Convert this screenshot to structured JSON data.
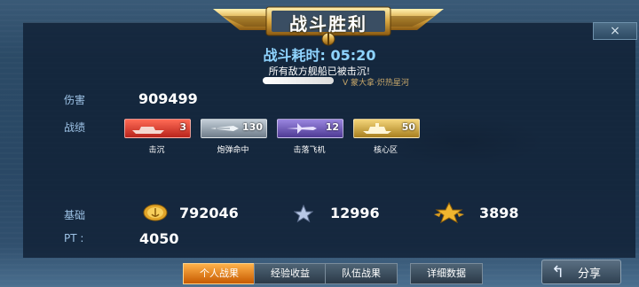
{
  "banner": {
    "title": "战斗胜利"
  },
  "close": {
    "icon": "×"
  },
  "summary": {
    "time_label": "战斗耗时:",
    "time_value": "05:20",
    "result": "所有敌方舰船已被击沉!",
    "player_info": "V 蒙大拿·炽热星河"
  },
  "stats": {
    "damage_label": "伤害",
    "damage_value": "909499",
    "record_label": "战绩",
    "badges": [
      {
        "icon": "ship-icon",
        "count": "3",
        "caption": "击沉",
        "color": "#d2352b"
      },
      {
        "icon": "shell-icon",
        "count": "130",
        "caption": "炮弹命中",
        "color": "#8a98a6"
      },
      {
        "icon": "aircraft-icon",
        "count": "12",
        "caption": "击落飞机",
        "color": "#6b55b0"
      },
      {
        "icon": "core-icon",
        "count": "50",
        "caption": "核心区",
        "color": "#c9a340"
      }
    ],
    "base_label": "基础",
    "gold_value": "792046",
    "silver_star_value": "12996",
    "gold_star_value": "3898",
    "pt_label": "PT :",
    "pt_value": "4050"
  },
  "tabs": [
    {
      "label": "个人战果",
      "active": true
    },
    {
      "label": "经验收益",
      "active": false
    },
    {
      "label": "队伍战果",
      "active": false
    },
    {
      "label": "详细数据",
      "active": false
    }
  ],
  "share": {
    "label": "分享",
    "icon": "share-arrow-icon"
  }
}
